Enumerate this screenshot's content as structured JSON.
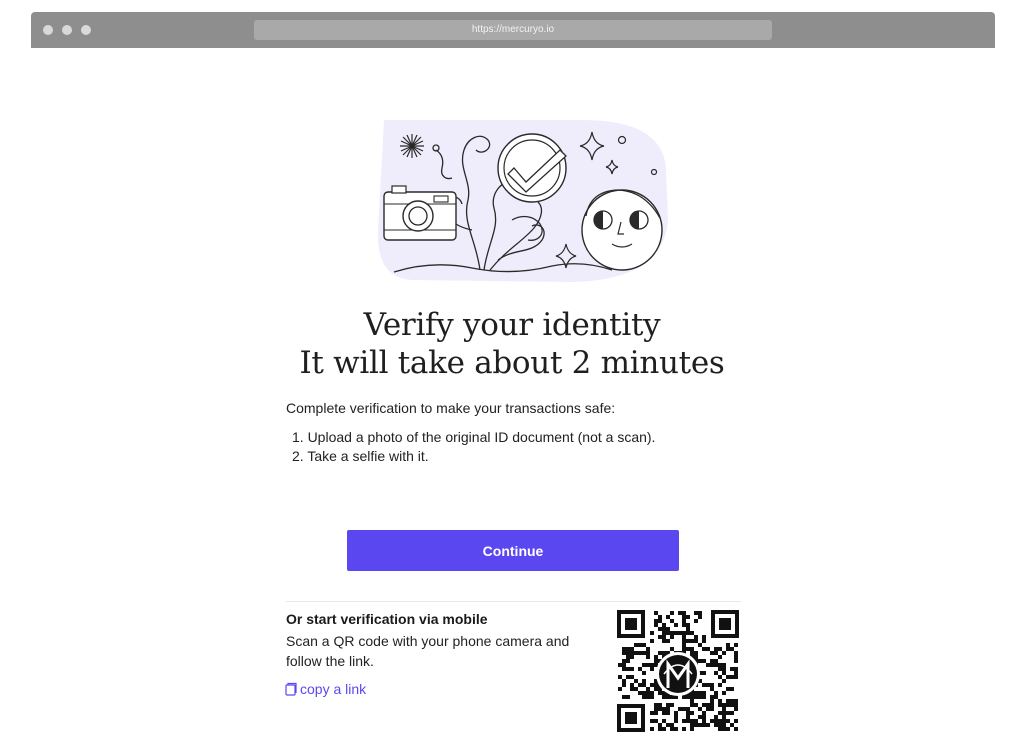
{
  "browser": {
    "url": "https://mercuryo.io"
  },
  "illustration": {
    "icon": "identity-verification-illustration",
    "accent_color": "#efedfb"
  },
  "heading": {
    "line1": "Verify your identity",
    "line2": "It will take about 2 minutes"
  },
  "intro": "Complete verification to make your transactions safe:",
  "steps": [
    "1. Upload a photo of the original ID document (not a scan).",
    "2. Take a selfie with it."
  ],
  "continue_label": "Continue",
  "mobile": {
    "title": "Or start verification via mobile",
    "description": "Scan a QR code with your phone camera and follow the link.",
    "copy_link_label": "copy a link"
  },
  "colors": {
    "primary": "#5b47ef",
    "chrome": "#8e8e8e"
  }
}
